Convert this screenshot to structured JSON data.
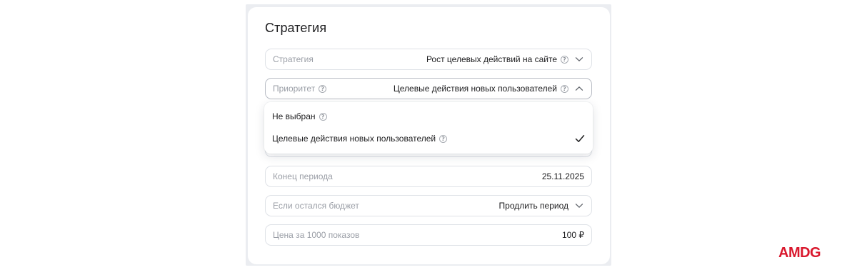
{
  "card": {
    "title": "Стратегия"
  },
  "fields": {
    "strategy": {
      "label": "Стратегия",
      "value": "Рост целевых действий на сайте"
    },
    "priority": {
      "label": "Приоритет",
      "value": "Целевые действия новых пользователей"
    },
    "end_period": {
      "label": "Конец периода",
      "value": "25.11.2025"
    },
    "budget_left": {
      "label": "Если остался бюджет",
      "value": "Продлить период"
    },
    "price_per_1000": {
      "label": "Цена за 1000 показов",
      "value": "100 ₽"
    }
  },
  "dropdown": {
    "options": [
      {
        "label": "Не выбран",
        "selected": false
      },
      {
        "label": "Целевые действия новых пользователей",
        "selected": true
      }
    ]
  },
  "help_glyph": "?",
  "icons": {
    "help": "question-circle-icon",
    "chevron_down": "chevron-down-icon",
    "chevron_up": "chevron-up-icon",
    "check": "checkmark-icon"
  },
  "brand": {
    "logo_text": "AMDG",
    "color": "#d9182d"
  }
}
